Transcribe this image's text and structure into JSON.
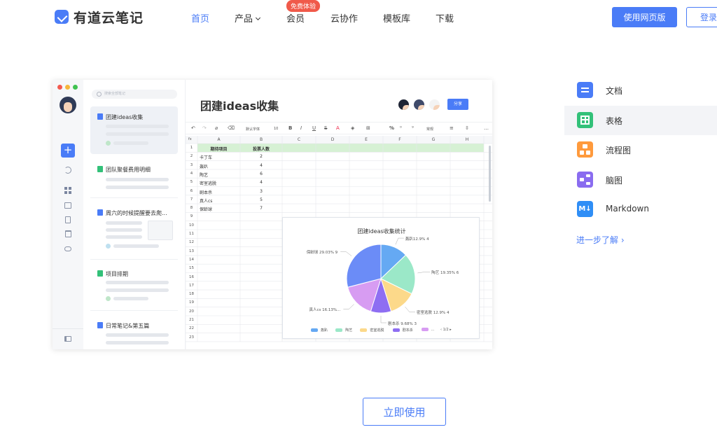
{
  "brand": {
    "name": "有道云笔记"
  },
  "nav": {
    "items": [
      {
        "label": "首页"
      },
      {
        "label": "产品"
      },
      {
        "label": "会员"
      },
      {
        "label": "云协作"
      },
      {
        "label": "模板库"
      },
      {
        "label": "下载"
      }
    ],
    "member_badge": "免费体验"
  },
  "header": {
    "web_button": "使用网页版",
    "login_button": "登录"
  },
  "app": {
    "search_placeholder": "搜索全部笔记",
    "notes": [
      {
        "title": "团建ideas收集"
      },
      {
        "title": "团队聚餐费用明细"
      },
      {
        "title": "周六的时候提醒要去爬..."
      },
      {
        "title": "项目排期"
      },
      {
        "title": "日常笔记&第五篇"
      }
    ],
    "doc_title": "团建ideas收集",
    "share_label": "分享",
    "toolbar": {
      "font": "默认字体",
      "size": "10",
      "bold": "B",
      "italic": "I",
      "underline": "U",
      "strike": "S",
      "percent": "%",
      "number_format": "常规"
    },
    "sheet": {
      "col_headers": [
        "A",
        "B",
        "C",
        "D",
        "E",
        "F",
        "G",
        "H"
      ],
      "fx": "fx",
      "header_row": [
        "期待项目",
        "投票人数"
      ],
      "rows": [
        [
          "卡丁车",
          "2"
        ],
        [
          "轰趴",
          "4"
        ],
        [
          "陶艺",
          "6"
        ],
        [
          "密室逃脱",
          "4"
        ],
        [
          "剧本杀",
          "3"
        ],
        [
          "真人cs",
          "5"
        ],
        [
          "保龄球",
          "7"
        ]
      ],
      "row_numbers": [
        "1",
        "2",
        "3",
        "4",
        "5",
        "6",
        "7",
        "8",
        "9",
        "10",
        "11",
        "12",
        "13",
        "14",
        "15",
        "16",
        "17",
        "18",
        "19",
        "20",
        "21",
        "22",
        "23"
      ]
    }
  },
  "chart_data": {
    "type": "pie",
    "title": "团建ideas收集统计",
    "slices": [
      {
        "name": "轰趴",
        "value": 4,
        "label": "轰趴12.9% 4",
        "color": "#65a9f3"
      },
      {
        "name": "陶艺",
        "value": 6,
        "label": "陶艺 19.35% 6",
        "color": "#9be8c8"
      },
      {
        "name": "密室逃脱",
        "value": 4,
        "label": "密室逃脱 12.9% 4",
        "color": "#fcd98a"
      },
      {
        "name": "剧本杀",
        "value": 3,
        "label": "剧本杀 9.68% 3",
        "color": "#8e6ef2"
      },
      {
        "name": "真人cs",
        "value": 5,
        "label": "真人cs 16.13%...",
        "color": "#d79cf2"
      },
      {
        "name": "保龄球",
        "value": 9,
        "label": "保龄球 29.03% 9",
        "color": "#6b8cf7"
      }
    ],
    "legend": [
      "轰趴",
      "陶艺",
      "密室逃脱",
      "剧本杀",
      "..."
    ],
    "legend_page": "1/2",
    "legend_placement": "bottom"
  },
  "right_panel": {
    "items": [
      {
        "label": "文档",
        "color": "#4a7cf7"
      },
      {
        "label": "表格",
        "color": "#33c179"
      },
      {
        "label": "流程图",
        "color": "#ff9a3c"
      },
      {
        "label": "脑图",
        "color": "#8a6cf0"
      },
      {
        "label": "Markdown",
        "color": "#2f8ef6"
      }
    ],
    "more_link": "进一步了解 ›"
  },
  "cta": {
    "label": "立即使用"
  }
}
